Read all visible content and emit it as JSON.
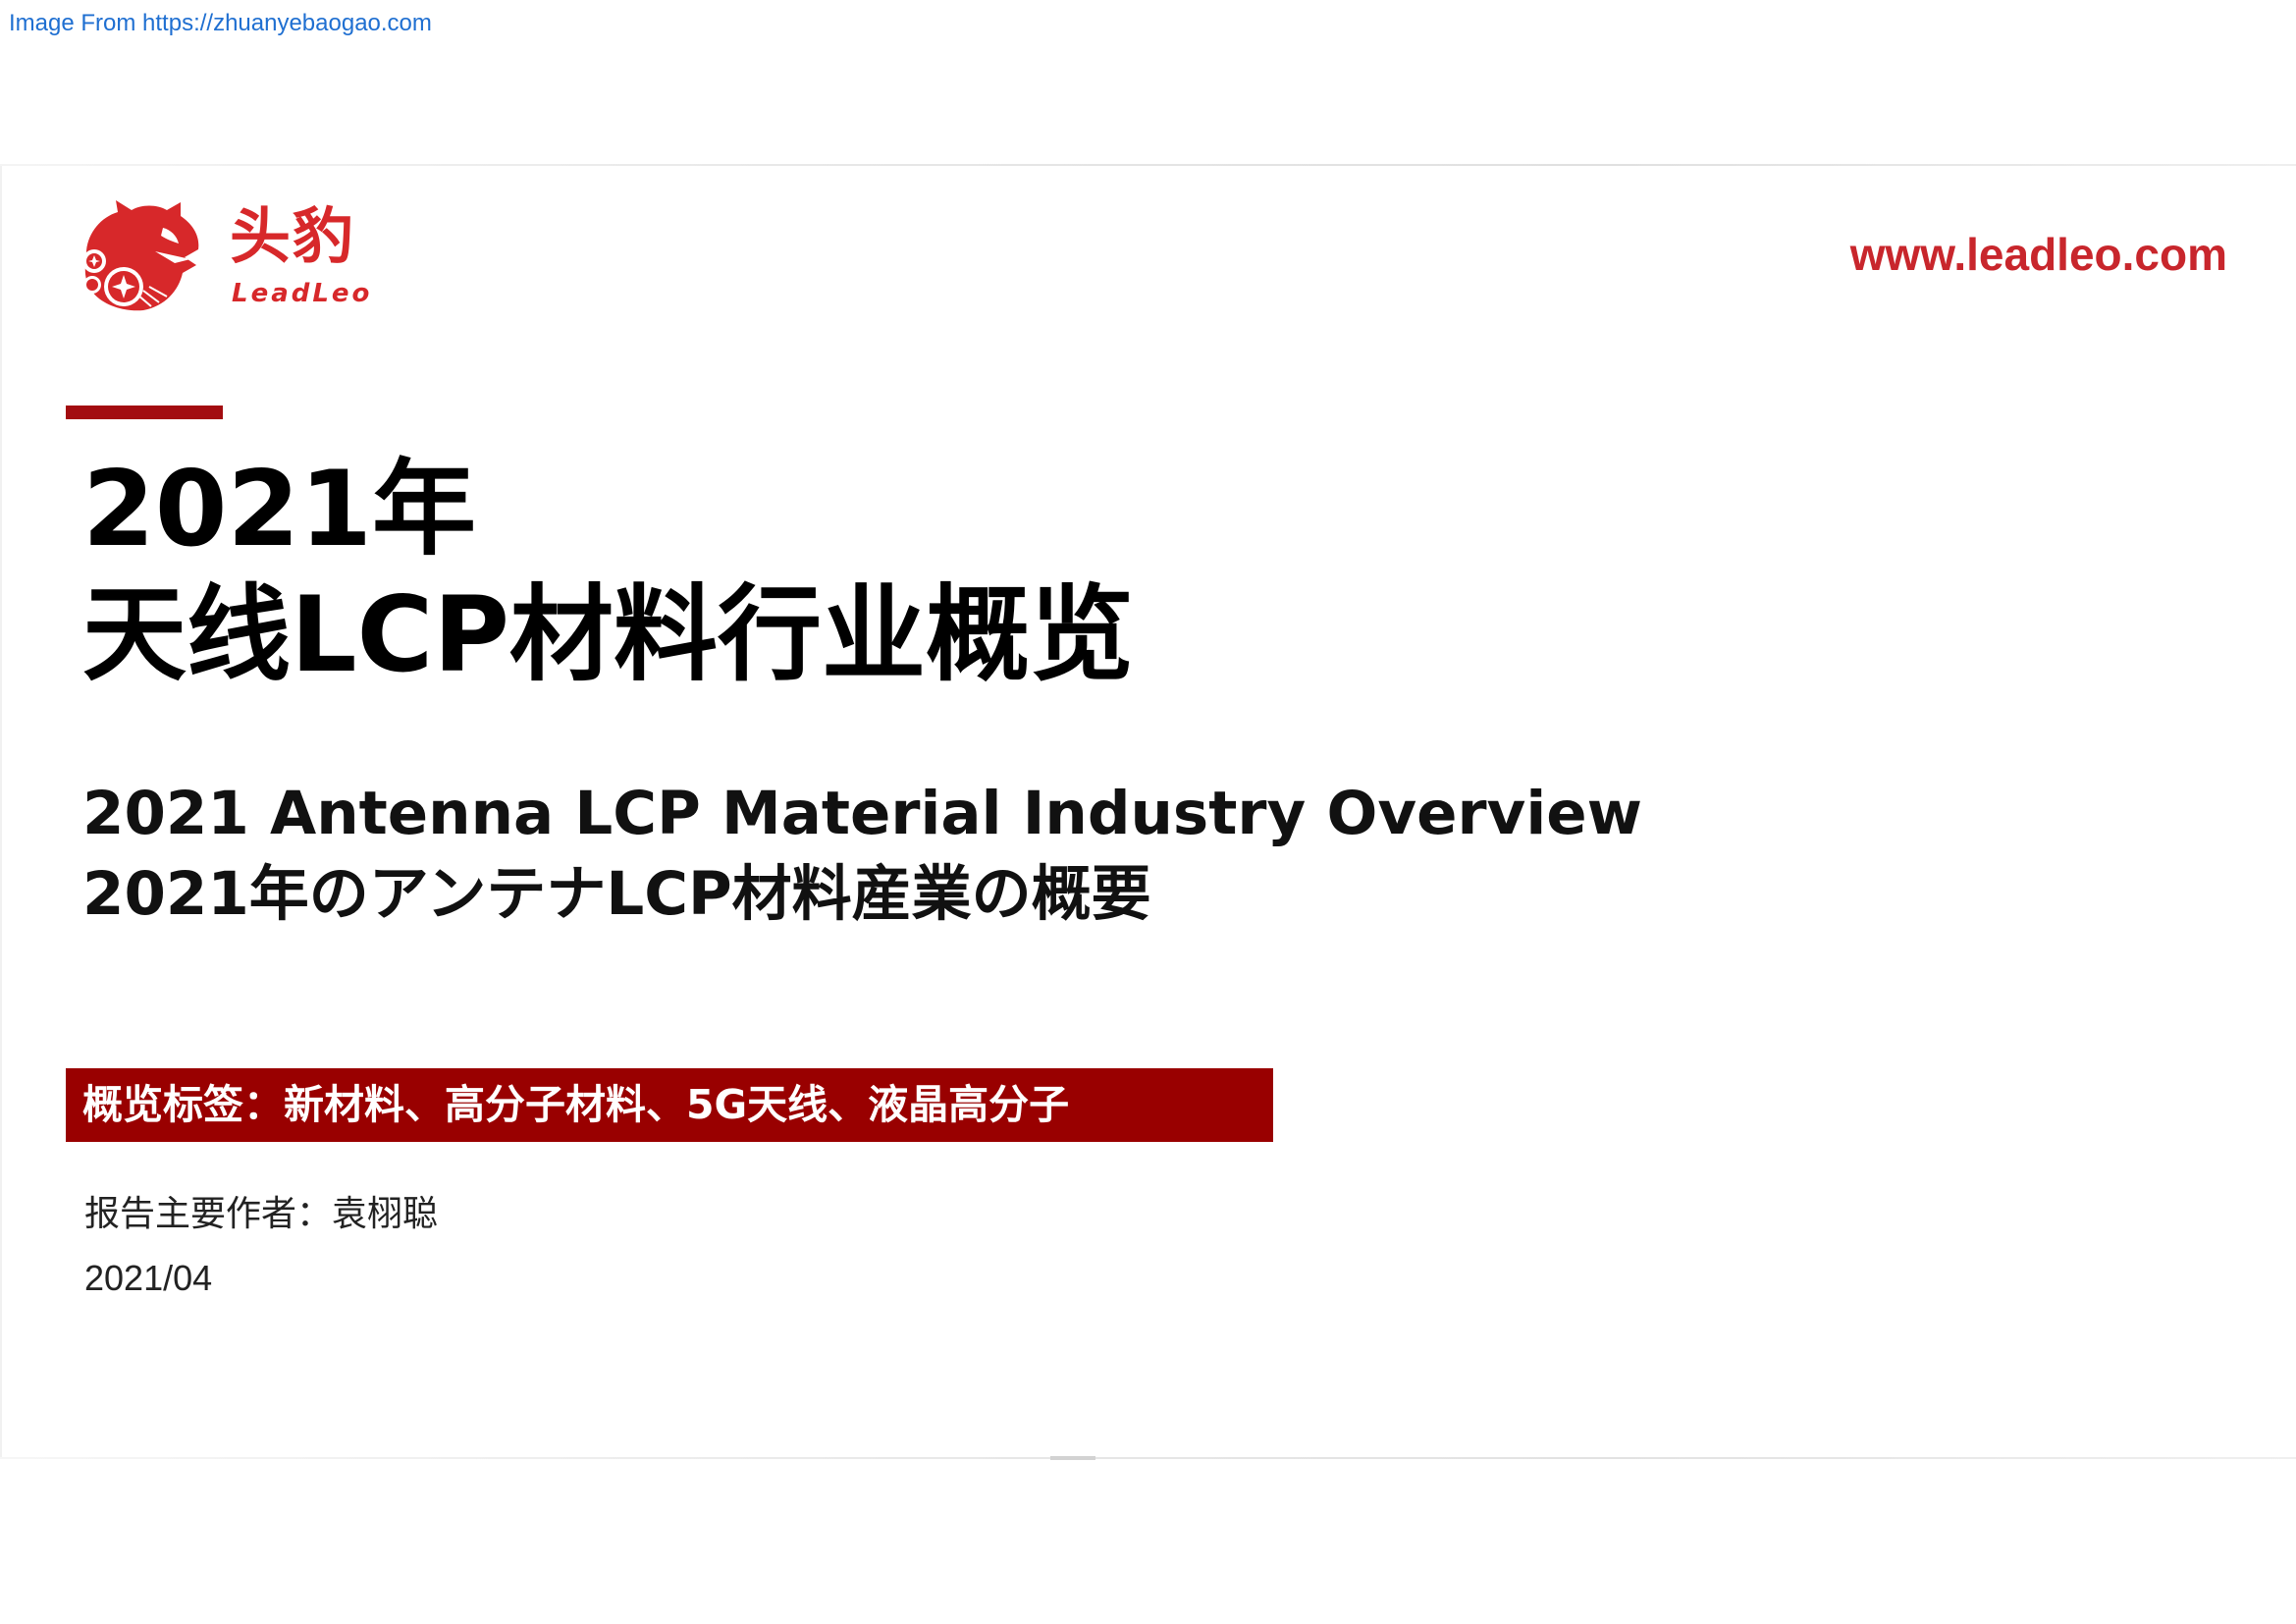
{
  "source": {
    "text": "Image From https://zhuanyebaogao.com"
  },
  "brand": {
    "name_cn": "头豹",
    "name_en": "LeadLeo",
    "logo_icon": "leopard-head-icon",
    "website": "www.leadleo.com",
    "color": "#d7282a"
  },
  "cover": {
    "title_line1": "2021年",
    "title_line2": "天线LCP材料行业概览",
    "subtitle_en": "2021 Antenna LCP Material Industry Overview",
    "subtitle_jp": "2021年のアンテナLCP材料産業の概要",
    "tags": "概览标签：新材料、高分子材料、5G天线、液晶高分子",
    "author": "报告主要作者：袁栩聪",
    "date": "2021/04",
    "accent_color": "#990000"
  }
}
